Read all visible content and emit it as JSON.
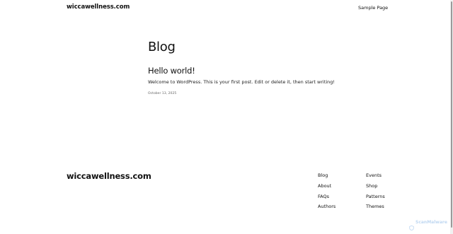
{
  "header": {
    "site_title": "wiccawellness.com",
    "nav": {
      "sample_page": "Sample Page"
    }
  },
  "main": {
    "page_heading": "Blog",
    "post": {
      "title": "Hello world!",
      "excerpt": "Welcome to WordPress. This is your first post. Edit or delete it, then start writing!",
      "date": "October 13, 2025"
    }
  },
  "footer": {
    "site_title": "wiccawellness.com",
    "links_col1": [
      "Blog",
      "About",
      "FAQs",
      "Authors"
    ],
    "links_col2": [
      "Events",
      "Shop",
      "Patterns",
      "Themes"
    ]
  },
  "watermark": {
    "text": "ScanMalware",
    "icon": "shield-icon",
    "color": "#4a8fd8"
  }
}
